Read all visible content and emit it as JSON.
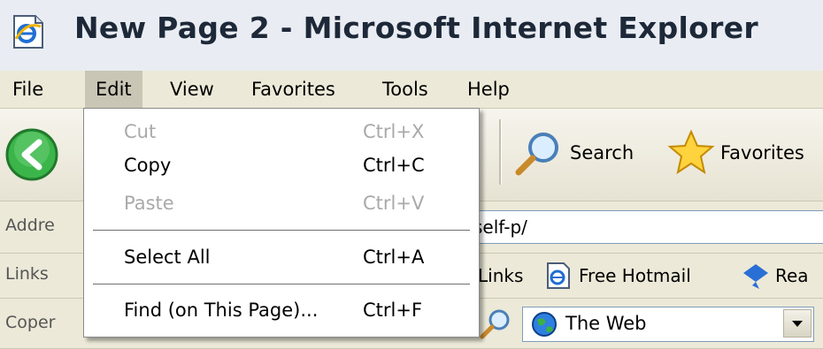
{
  "window": {
    "title": "New Page 2 - Microsoft Internet Explorer",
    "icon": "ie-page-icon"
  },
  "menubar": {
    "items": [
      {
        "label": "File"
      },
      {
        "label": "Edit",
        "active": true
      },
      {
        "label": "View"
      },
      {
        "label": "Favorites"
      },
      {
        "label": "Tools"
      },
      {
        "label": "Help"
      }
    ]
  },
  "toolbar": {
    "back_icon": "back-arrow-icon",
    "search_label": "Search",
    "favorites_label": "Favorites"
  },
  "address_bar": {
    "label": "Addre",
    "value": "self-p/"
  },
  "links_bar": {
    "label": "Links",
    "items": [
      "Links",
      "Free Hotmail",
      "Rea"
    ]
  },
  "search_bar": {
    "label": "Coper",
    "combo_value": "The Web"
  },
  "edit_menu": {
    "items": [
      {
        "label": "Cut",
        "shortcut": "Ctrl+X",
        "enabled": false
      },
      {
        "label": "Copy",
        "shortcut": "Ctrl+C",
        "enabled": true
      },
      {
        "label": "Paste",
        "shortcut": "Ctrl+V",
        "enabled": false
      },
      {
        "label": "Select All",
        "shortcut": "Ctrl+A",
        "enabled": true
      },
      {
        "label": "Find (on This Page)...",
        "shortcut": "Ctrl+F",
        "enabled": true
      }
    ]
  },
  "colors": {
    "menu_active": "#c9c6b6",
    "back_green": "#3bb54a",
    "favorites_star": "#ffd33d",
    "disabled_text": "#a9a9a9"
  }
}
